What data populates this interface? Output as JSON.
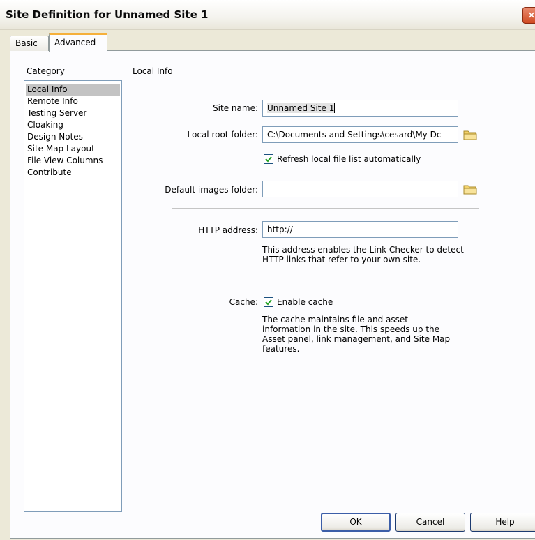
{
  "window": {
    "title": "Site Definition for Unnamed Site 1",
    "close_glyph": "✕"
  },
  "tabs": [
    {
      "label": "Basic",
      "active": false
    },
    {
      "label": "Advanced",
      "active": true
    }
  ],
  "category": {
    "heading": "Category",
    "items": [
      {
        "label": "Local Info",
        "selected": true
      },
      {
        "label": "Remote Info",
        "selected": false
      },
      {
        "label": "Testing Server",
        "selected": false
      },
      {
        "label": "Cloaking",
        "selected": false
      },
      {
        "label": "Design Notes",
        "selected": false
      },
      {
        "label": "Site Map Layout",
        "selected": false
      },
      {
        "label": "File View Columns",
        "selected": false
      },
      {
        "label": "Contribute",
        "selected": false
      }
    ]
  },
  "section": {
    "title": "Local Info"
  },
  "fields": {
    "site_name": {
      "label": "Site name:",
      "value": "Unnamed Site 1"
    },
    "local_root": {
      "label": "Local root folder:",
      "value": "C:\\Documents and Settings\\cesard\\My Dc"
    },
    "refresh": {
      "prefix": "R",
      "rest": "efresh local file list automatically",
      "checked": true
    },
    "images_folder": {
      "label": "Default images folder:",
      "value": ""
    },
    "http": {
      "label": "HTTP address:",
      "value": "http://",
      "help": "This address enables the Link Checker to detect HTTP links that refer to your own site."
    },
    "cache": {
      "label": "Cache:",
      "prefix": "E",
      "rest": "nable cache",
      "checked": true,
      "help": "The cache maintains file and asset information in the site.  This speeds up the Asset panel, link management, and Site Map features."
    }
  },
  "buttons": {
    "ok": "OK",
    "cancel": "Cancel",
    "help": "Help"
  },
  "icons": {
    "folder": "folder-icon",
    "checkmark": "checkmark-icon",
    "close": "close-icon"
  },
  "colors": {
    "selected_item": "#c3c3c3",
    "check": "#21a121",
    "folder": "#f3d26b",
    "accent_tab": "#f5b03b"
  }
}
